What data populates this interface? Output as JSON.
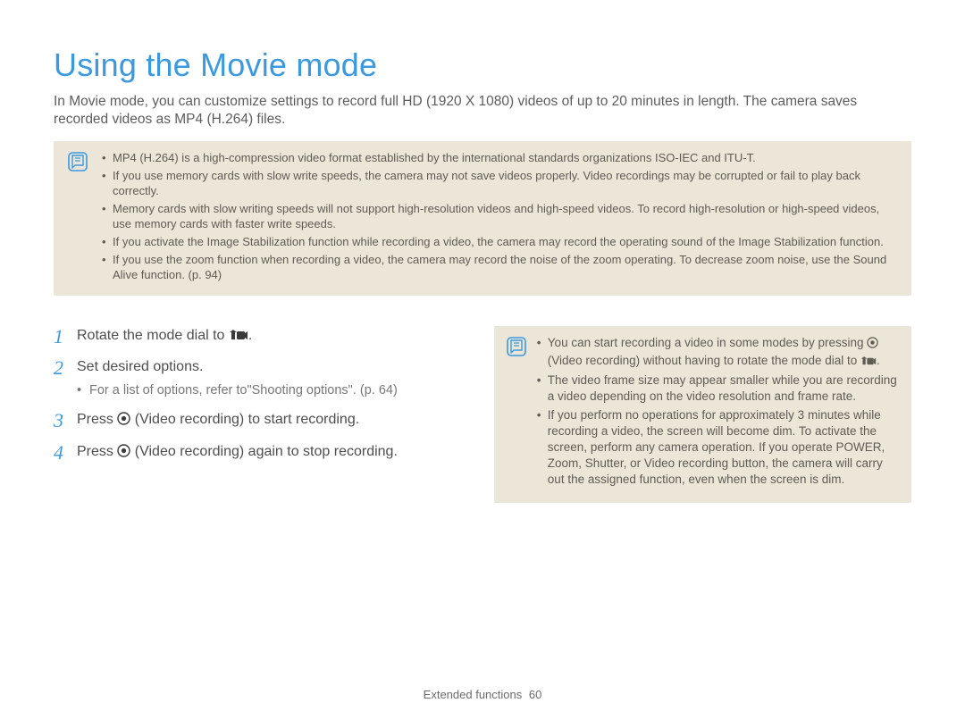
{
  "title": "Using the Movie mode",
  "intro": "In Movie mode, you can customize settings to record full HD (1920 X 1080) videos of up to 20 minutes in length. The camera saves recorded videos as MP4 (H.264) files.",
  "note_items": [
    "MP4 (H.264) is a high-compression video format established by the international standards organizations ISO-IEC and ITU-T.",
    "If you use memory cards with slow write speeds, the camera may not save videos properly. Video recordings may be corrupted or fail to play back correctly.",
    "Memory cards with slow writing speeds will not support high-resolution videos and high-speed videos. To record high-resolution or high-speed videos, use memory cards with faster write speeds.",
    "If you activate the Image Stabilization function while recording a video, the camera may record the operating sound of the Image Stabilization function.",
    "If you use the zoom function when recording a video, the camera may record the noise of the zoom operating. To decrease zoom noise, use the Sound Alive function. (p. 94)"
  ],
  "steps": {
    "s1": {
      "num": "1",
      "pre": "Rotate the mode dial to ",
      "post": "."
    },
    "s2": {
      "num": "2",
      "text": "Set desired options.",
      "sub": "For a list of options, refer to\"Shooting options\". (p. 64)"
    },
    "s3": {
      "num": "3",
      "pre": "Press ",
      "mid": " (Video recording) to start recording."
    },
    "s4": {
      "num": "4",
      "pre": "Press ",
      "mid": " (Video recording) again to stop recording."
    }
  },
  "side_note": {
    "item1_pre": "You can start recording a video in some modes by pressing ",
    "item1_mid": " (Video recording) without having to rotate the mode dial to ",
    "item1_post": ".",
    "item2": "The video frame size may appear smaller while you are recording a video depending on the video resolution and frame rate.",
    "item3": "If you perform no operations for approximately 3 minutes while recording a video, the screen will become dim. To activate the screen, perform any camera operation. If you operate POWER, Zoom, Shutter, or Video recording button, the camera will carry out the assigned function, even when the screen is dim."
  },
  "footer": {
    "section": "Extended functions",
    "page": "60"
  },
  "icons": {
    "note": "note-icon",
    "movie_mode": "movie-mode-icon",
    "record": "record-button-icon"
  }
}
